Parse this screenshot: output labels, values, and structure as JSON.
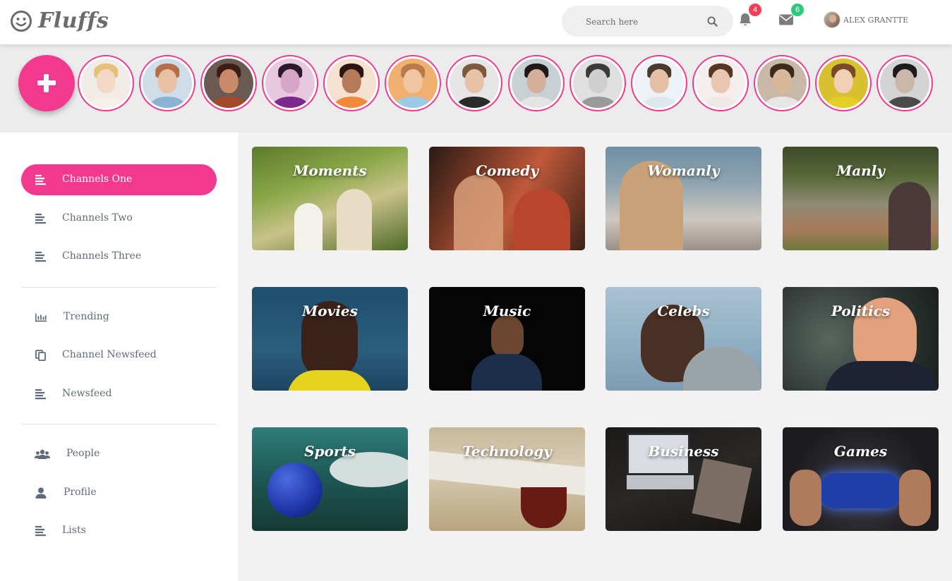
{
  "header": {
    "logo_text": "Fluffs",
    "search_placeholder": "Search here",
    "notifications_count": "4",
    "messages_count": "6",
    "user_name": "ALEX GRANTTE",
    "colors": {
      "accent": "#f2388f",
      "badge_red": "#ef4058",
      "badge_green": "#2dc97a"
    }
  },
  "stories": {
    "add_icon": "plus-icon",
    "count": 14
  },
  "sidebar": {
    "groups": [
      [
        {
          "label": "Channels One",
          "icon": "list-icon",
          "active": true
        },
        {
          "label": "Channels Two",
          "icon": "list-icon",
          "active": false
        },
        {
          "label": "Channels Three",
          "icon": "list-icon",
          "active": false
        }
      ],
      [
        {
          "label": "Trending",
          "icon": "bar-chart-icon",
          "active": false
        },
        {
          "label": "Channel Newsfeed",
          "icon": "copy-icon",
          "active": false
        },
        {
          "label": "Newsfeed",
          "icon": "list-icon",
          "active": false
        }
      ],
      [
        {
          "label": "People",
          "icon": "users-icon",
          "active": false
        },
        {
          "label": "Profile",
          "icon": "user-icon",
          "active": false
        },
        {
          "label": "Lists",
          "icon": "list-icon",
          "active": false
        }
      ]
    ]
  },
  "channels": [
    {
      "title": "Moments"
    },
    {
      "title": "Comedy"
    },
    {
      "title": "Womanly"
    },
    {
      "title": "Manly"
    },
    {
      "title": "Movies"
    },
    {
      "title": "Music"
    },
    {
      "title": "Celebs"
    },
    {
      "title": "Politics"
    },
    {
      "title": "Sports"
    },
    {
      "title": "Technology"
    },
    {
      "title": "Business"
    },
    {
      "title": "Games"
    }
  ]
}
